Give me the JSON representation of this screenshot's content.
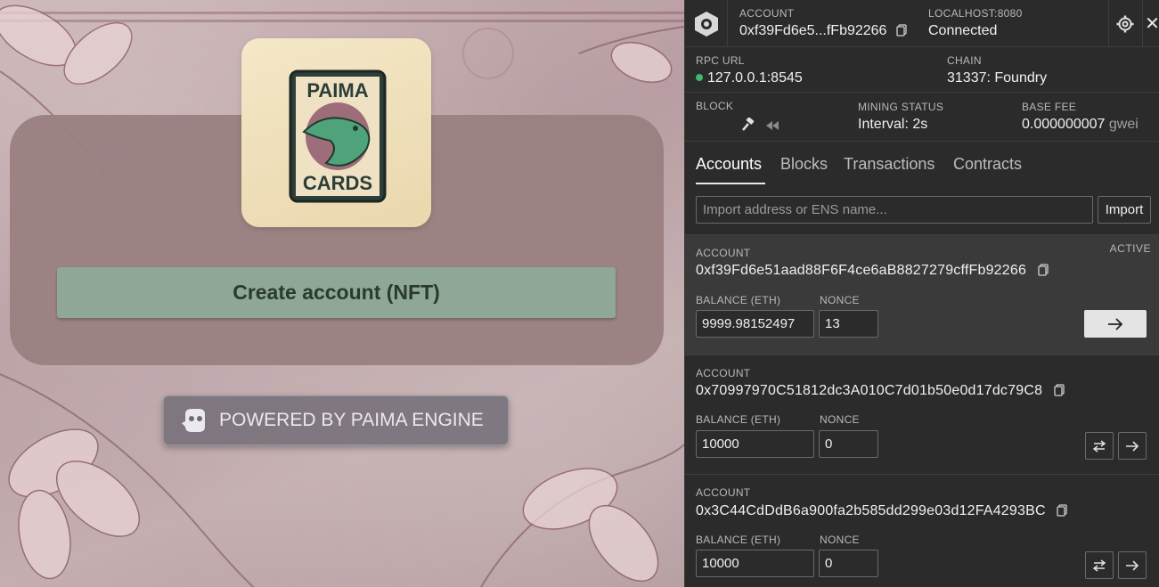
{
  "game": {
    "logo_top_text": "PAIMA",
    "logo_bottom_text": "CARDS",
    "create_button": "Create account (NFT)",
    "powered_by": "POWERED BY PAIMA ENGINE",
    "colors": {
      "panel_bg": "#9a8081",
      "button_bg": "#8fa797",
      "button_text": "#2a3a2e"
    }
  },
  "devtools": {
    "header": {
      "account_label": "ACCOUNT",
      "account_value": "0xf39Fd6e5...fFb92266",
      "host_label": "LOCALHOST:8080",
      "host_value": "Connected"
    },
    "rpc": {
      "rpc_label": "RPC URL",
      "rpc_value": "127.0.0.1:8545",
      "chain_label": "CHAIN",
      "chain_value": "31337: Foundry"
    },
    "block": {
      "block_label": "BLOCK",
      "mining_label": "MINING STATUS",
      "mining_value": "Interval: 2s",
      "fee_label": "BASE FEE",
      "fee_value": "0.000000007",
      "fee_unit": "gwei"
    },
    "tabs": [
      "Accounts",
      "Blocks",
      "Transactions",
      "Contracts"
    ],
    "import": {
      "placeholder": "Import address or ENS name...",
      "button": "Import"
    },
    "accounts": [
      {
        "label": "ACCOUNT",
        "address": "0xf39Fd6e51aad88F6F4ce6aB8827279cffFb92266",
        "status": "ACTIVE",
        "balance_label": "BALANCE (ETH)",
        "balance": "9999.98152497",
        "nonce_label": "NONCE",
        "nonce": "13"
      },
      {
        "label": "ACCOUNT",
        "address": "0x70997970C51812dc3A010C7d01b50e0d17dc79C8",
        "balance_label": "BALANCE (ETH)",
        "balance": "10000",
        "nonce_label": "NONCE",
        "nonce": "0"
      },
      {
        "label": "ACCOUNT",
        "address": "0x3C44CdDdB6a900fa2b585dd299e03d12FA4293BC",
        "balance_label": "BALANCE (ETH)",
        "balance": "10000",
        "nonce_label": "NONCE",
        "nonce": "0"
      }
    ],
    "colors": {
      "bg": "#2b2b2b",
      "active_bg": "#3a3a3a",
      "status_dot": "#3fb96a"
    }
  }
}
